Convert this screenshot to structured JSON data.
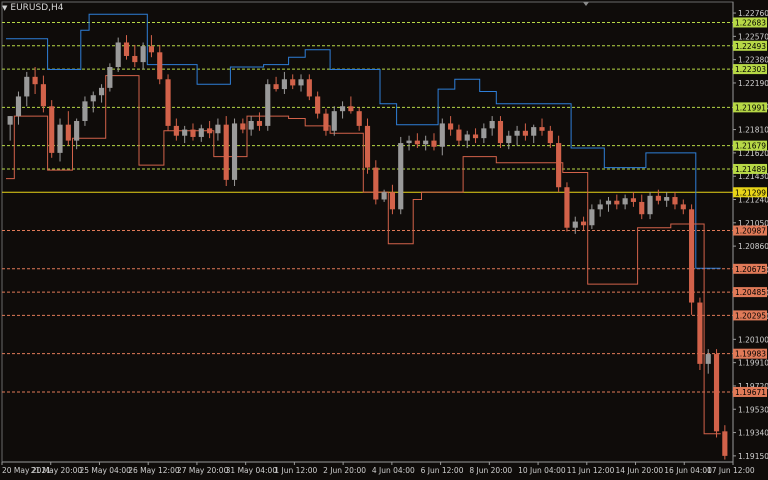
{
  "window": {
    "title": "EURUSD,H4"
  },
  "chart_data": {
    "type": "candlestick",
    "symbol": "EURUSD",
    "timeframe": "H4",
    "ylim": [
      1.191,
      1.2285
    ],
    "x_labels": [
      "20 May 2021",
      "21 May 20:00",
      "25 May 04:00",
      "26 May 12:00",
      "27 May 20:00",
      "31 May 04:00",
      "1 Jun 12:00",
      "2 Jun 20:00",
      "4 Jun 04:00",
      "6 Jun 12:00",
      "8 Jun 20:00",
      "10 Jun 04:00",
      "11 Jun 12:00",
      "14 Jun 20:00",
      "16 Jun 04:00",
      "17 Jun 12:00"
    ],
    "y_ticks": [
      "1.22760",
      "1.22570",
      "1.22380",
      "1.22190",
      "1.22000",
      "1.21810",
      "1.21620",
      "1.21430",
      "1.21240",
      "1.21050",
      "1.20860",
      "1.20670",
      "1.20480",
      "1.20290",
      "1.20100",
      "1.19910",
      "1.19720",
      "1.19530",
      "1.19340",
      "1.19150"
    ],
    "resistance_levels": [
      "1.22683",
      "1.22493",
      "1.22303",
      "1.21991",
      "1.21679",
      "1.21489"
    ],
    "support_levels": [
      "1.20987",
      "1.20675",
      "1.20485",
      "1.20295",
      "1.19983",
      "1.19671"
    ],
    "current_price": "1.21299",
    "colors": {
      "bull": "#9a9a9a",
      "bear": "#d2624a",
      "upper_band": "#2f7fd8",
      "lower_band": "#d2624a",
      "resistance": "#b7d846",
      "support": "#e07a58",
      "current": "#e8d418"
    },
    "candles": [
      [
        1.2185,
        1.2192,
        1.2172,
        1.2192
      ],
      [
        1.2192,
        1.2212,
        1.2185,
        1.2208
      ],
      [
        1.2208,
        1.2228,
        1.22,
        1.2224
      ],
      [
        1.2224,
        1.2232,
        1.221,
        1.2218
      ],
      [
        1.2218,
        1.2225,
        1.2195,
        1.22
      ],
      [
        1.22,
        1.2205,
        1.2158,
        1.2162
      ],
      [
        1.2162,
        1.219,
        1.2155,
        1.2185
      ],
      [
        1.2185,
        1.2196,
        1.2168,
        1.2172
      ],
      [
        1.2172,
        1.219,
        1.2165,
        1.2188
      ],
      [
        1.2188,
        1.2208,
        1.2184,
        1.2204
      ],
      [
        1.2204,
        1.2212,
        1.2195,
        1.2209
      ],
      [
        1.2209,
        1.2218,
        1.2203,
        1.2215
      ],
      [
        1.2215,
        1.2235,
        1.2212,
        1.2232
      ],
      [
        1.2232,
        1.2256,
        1.2228,
        1.2252
      ],
      [
        1.2252,
        1.2258,
        1.2238,
        1.2241
      ],
      [
        1.2241,
        1.225,
        1.2232,
        1.2236
      ],
      [
        1.2236,
        1.2252,
        1.223,
        1.2249
      ],
      [
        1.2249,
        1.2258,
        1.224,
        1.2244
      ],
      [
        1.2244,
        1.225,
        1.2218,
        1.2222
      ],
      [
        1.2222,
        1.2226,
        1.218,
        1.2184
      ],
      [
        1.2184,
        1.219,
        1.2172,
        1.2176
      ],
      [
        1.2176,
        1.2184,
        1.217,
        1.2181
      ],
      [
        1.2181,
        1.2186,
        1.2172,
        1.2175
      ],
      [
        1.2175,
        1.2185,
        1.2171,
        1.2182
      ],
      [
        1.2182,
        1.2188,
        1.2174,
        1.2178
      ],
      [
        1.2178,
        1.219,
        1.2172,
        1.2185
      ],
      [
        1.2185,
        1.2192,
        1.2135,
        1.214
      ],
      [
        1.214,
        1.219,
        1.2135,
        1.2186
      ],
      [
        1.2186,
        1.219,
        1.2178,
        1.2181
      ],
      [
        1.2181,
        1.2192,
        1.2176,
        1.2188
      ],
      [
        1.2188,
        1.2195,
        1.218,
        1.2184
      ],
      [
        1.2184,
        1.2222,
        1.218,
        1.2218
      ],
      [
        1.2218,
        1.2224,
        1.2212,
        1.2214
      ],
      [
        1.2214,
        1.2228,
        1.221,
        1.2222
      ],
      [
        1.2222,
        1.2226,
        1.2214,
        1.2217
      ],
      [
        1.2217,
        1.2226,
        1.2212,
        1.2222
      ],
      [
        1.2222,
        1.2226,
        1.2205,
        1.2208
      ],
      [
        1.2208,
        1.2212,
        1.219,
        1.2194
      ],
      [
        1.2194,
        1.2198,
        1.2176,
        1.218
      ],
      [
        1.218,
        1.22,
        1.2176,
        1.2196
      ],
      [
        1.2196,
        1.2204,
        1.219,
        1.22
      ],
      [
        1.22,
        1.2208,
        1.2194,
        1.2196
      ],
      [
        1.2196,
        1.2199,
        1.218,
        1.2184
      ],
      [
        1.2184,
        1.219,
        1.2145,
        1.215
      ],
      [
        1.215,
        1.2156,
        1.212,
        1.2124
      ],
      [
        1.2124,
        1.2132,
        1.2122,
        1.213
      ],
      [
        1.213,
        1.2136,
        1.2112,
        1.2116
      ],
      [
        1.2116,
        1.2175,
        1.2112,
        1.217
      ],
      [
        1.217,
        1.2176,
        1.2164,
        1.2172
      ],
      [
        1.2172,
        1.2178,
        1.2166,
        1.2169
      ],
      [
        1.2169,
        1.2176,
        1.2164,
        1.2172
      ],
      [
        1.2172,
        1.2178,
        1.2164,
        1.2167
      ],
      [
        1.2167,
        1.219,
        1.216,
        1.2186
      ],
      [
        1.2186,
        1.2192,
        1.2176,
        1.2181
      ],
      [
        1.2181,
        1.2185,
        1.2168,
        1.2172
      ],
      [
        1.2172,
        1.218,
        1.2166,
        1.2177
      ],
      [
        1.2177,
        1.2182,
        1.217,
        1.2174
      ],
      [
        1.2174,
        1.2186,
        1.217,
        1.2182
      ],
      [
        1.2182,
        1.2192,
        1.2176,
        1.2188
      ],
      [
        1.2188,
        1.2192,
        1.2166,
        1.217
      ],
      [
        1.217,
        1.218,
        1.2165,
        1.2176
      ],
      [
        1.2176,
        1.2184,
        1.2168,
        1.218
      ],
      [
        1.218,
        1.2186,
        1.2172,
        1.2176
      ],
      [
        1.2176,
        1.2185,
        1.217,
        1.2183
      ],
      [
        1.2183,
        1.219,
        1.2176,
        1.218
      ],
      [
        1.218,
        1.2184,
        1.2166,
        1.217
      ],
      [
        1.217,
        1.2176,
        1.213,
        1.2134
      ],
      [
        1.2134,
        1.2138,
        1.2098,
        1.2101
      ],
      [
        1.2101,
        1.211,
        1.2096,
        1.2106
      ],
      [
        1.2106,
        1.211,
        1.2099,
        1.2103
      ],
      [
        1.2103,
        1.212,
        1.21,
        1.2116
      ],
      [
        1.2116,
        1.2124,
        1.211,
        1.212
      ],
      [
        1.212,
        1.2126,
        1.2114,
        1.2123
      ],
      [
        1.2123,
        1.2128,
        1.2116,
        1.212
      ],
      [
        1.212,
        1.2128,
        1.2116,
        1.2125
      ],
      [
        1.2125,
        1.213,
        1.2118,
        1.2122
      ],
      [
        1.2122,
        1.2128,
        1.2108,
        1.2112
      ],
      [
        1.2112,
        1.213,
        1.2108,
        1.2127
      ],
      [
        1.2127,
        1.2132,
        1.212,
        1.2123
      ],
      [
        1.2123,
        1.213,
        1.2118,
        1.2126
      ],
      [
        1.2126,
        1.213,
        1.2116,
        1.212
      ],
      [
        1.212,
        1.2124,
        1.2112,
        1.2116
      ],
      [
        1.2116,
        1.212,
        1.203,
        1.204
      ],
      [
        1.204,
        1.2044,
        1.1985,
        1.199
      ],
      [
        1.199,
        1.2002,
        1.1982,
        1.1998
      ],
      [
        1.1998,
        1.2002,
        1.193,
        1.1935
      ],
      [
        1.1935,
        1.194,
        1.1912,
        1.1915
      ]
    ],
    "upper_band": [
      [
        0,
        1.2255
      ],
      [
        5,
        1.2255
      ],
      [
        5,
        1.223
      ],
      [
        9,
        1.223
      ],
      [
        9,
        1.2262
      ],
      [
        10,
        1.2262
      ],
      [
        10,
        1.2275
      ],
      [
        17,
        1.2275
      ],
      [
        17,
        1.2234
      ],
      [
        23,
        1.2234
      ],
      [
        23,
        1.2218
      ],
      [
        27,
        1.2218
      ],
      [
        27,
        1.2232
      ],
      [
        31,
        1.2232
      ],
      [
        31,
        1.2234
      ],
      [
        34,
        1.2234
      ],
      [
        34,
        1.224
      ],
      [
        36,
        1.224
      ],
      [
        36,
        1.2246
      ],
      [
        39,
        1.2246
      ],
      [
        39,
        1.223
      ],
      [
        45,
        1.223
      ],
      [
        45,
        1.2202
      ],
      [
        47,
        1.2202
      ],
      [
        47,
        1.2185
      ],
      [
        52,
        1.2185
      ],
      [
        52,
        1.2214
      ],
      [
        54,
        1.2214
      ],
      [
        54,
        1.2222
      ],
      [
        57,
        1.2222
      ],
      [
        57,
        1.2212
      ],
      [
        59,
        1.2212
      ],
      [
        59,
        1.2202
      ],
      [
        68,
        1.2202
      ],
      [
        68,
        1.2166
      ],
      [
        72,
        1.2166
      ],
      [
        72,
        1.215
      ],
      [
        77,
        1.215
      ],
      [
        77,
        1.2162
      ],
      [
        83,
        1.2162
      ],
      [
        83,
        1.2068
      ],
      [
        86,
        1.2068
      ]
    ],
    "lower_band": [
      [
        0,
        1.2141
      ],
      [
        1,
        1.2141
      ],
      [
        1,
        1.2192
      ],
      [
        5,
        1.2192
      ],
      [
        5,
        1.2148
      ],
      [
        8,
        1.2148
      ],
      [
        8,
        1.2174
      ],
      [
        12,
        1.2174
      ],
      [
        12,
        1.2225
      ],
      [
        16,
        1.2225
      ],
      [
        16,
        1.2152
      ],
      [
        19,
        1.2152
      ],
      [
        19,
        1.218
      ],
      [
        25,
        1.218
      ],
      [
        25,
        1.2159
      ],
      [
        29,
        1.2159
      ],
      [
        29,
        1.2192
      ],
      [
        34,
        1.2192
      ],
      [
        34,
        1.219
      ],
      [
        36,
        1.219
      ],
      [
        36,
        1.2184
      ],
      [
        39,
        1.2184
      ],
      [
        39,
        1.2178
      ],
      [
        43,
        1.2178
      ],
      [
        43,
        1.213
      ],
      [
        46,
        1.213
      ],
      [
        46,
        1.2088
      ],
      [
        49,
        1.2088
      ],
      [
        49,
        1.2124
      ],
      [
        50,
        1.2124
      ],
      [
        50,
        1.213
      ],
      [
        55,
        1.213
      ],
      [
        55,
        1.2159
      ],
      [
        59,
        1.2159
      ],
      [
        59,
        1.2154
      ],
      [
        67,
        1.2154
      ],
      [
        67,
        1.2146
      ],
      [
        70,
        1.2146
      ],
      [
        70,
        1.2055
      ],
      [
        76,
        1.2055
      ],
      [
        76,
        1.2101
      ],
      [
        80,
        1.2101
      ],
      [
        80,
        1.2104
      ],
      [
        84,
        1.2104
      ],
      [
        84,
        1.1933
      ],
      [
        86,
        1.1933
      ]
    ]
  }
}
